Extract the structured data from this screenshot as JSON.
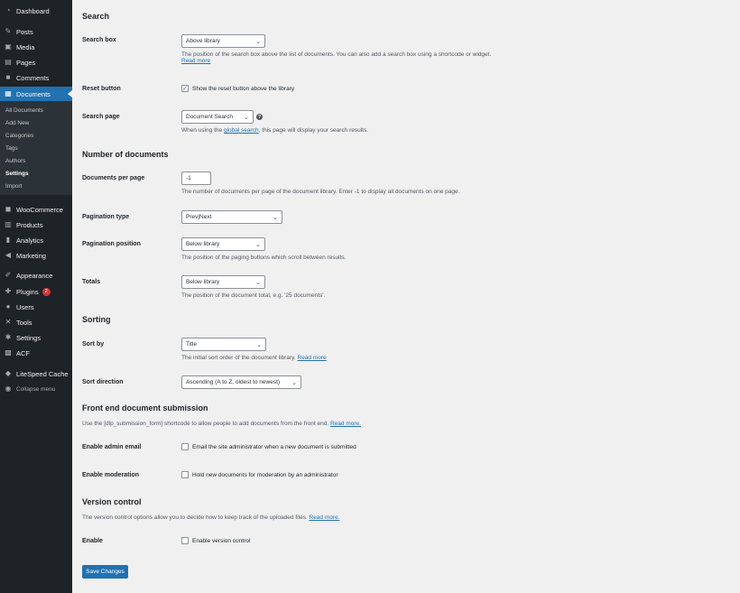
{
  "sidebar": {
    "items": [
      {
        "label": "Dashboard",
        "icon": "dashboard-icon"
      },
      {
        "label": "Posts",
        "icon": "pin-icon"
      },
      {
        "label": "Media",
        "icon": "media-icon"
      },
      {
        "label": "Pages",
        "icon": "pages-icon"
      },
      {
        "label": "Comments",
        "icon": "comments-icon"
      },
      {
        "label": "Documents",
        "icon": "document-icon"
      },
      {
        "label": "WooCommerce",
        "icon": "woocommerce-icon"
      },
      {
        "label": "Products",
        "icon": "products-icon"
      },
      {
        "label": "Analytics",
        "icon": "analytics-icon"
      },
      {
        "label": "Marketing",
        "icon": "megaphone-icon"
      },
      {
        "label": "Appearance",
        "icon": "brush-icon"
      },
      {
        "label": "Plugins",
        "icon": "plugin-icon",
        "badge": "2"
      },
      {
        "label": "Users",
        "icon": "users-icon"
      },
      {
        "label": "Tools",
        "icon": "wrench-icon"
      },
      {
        "label": "Settings",
        "icon": "settings-icon"
      },
      {
        "label": "ACF",
        "icon": "acf-icon"
      },
      {
        "label": "LiteSpeed Cache",
        "icon": "litespeed-icon"
      },
      {
        "label": "Collapse menu",
        "icon": "collapse-icon"
      }
    ],
    "submenu": [
      "All Documents",
      "Add New",
      "Categories",
      "Tags",
      "Authors",
      "Settings",
      "Import"
    ]
  },
  "search": {
    "title": "Search",
    "box_label": "Search box",
    "box_value": "Above library",
    "box_desc": "The position of the search box above the list of documents. You can also add a search box using a shortcode or widget.",
    "read_more": "Read more",
    "reset_label": "Reset button",
    "reset_text": "Show the reset button above the library",
    "reset_checked": true,
    "page_label": "Search page",
    "page_value": "Document Search",
    "page_desc_pre": "When using the",
    "page_desc_link": "global search",
    "page_desc_post": ", this page will display your search results."
  },
  "number": {
    "title": "Number of documents",
    "per_page_label": "Documents per page",
    "per_page_value": "-1",
    "per_page_desc": "The number of documents per page of the document library. Enter -1 to display all documents on one page.",
    "pag_type_label": "Pagination type",
    "pag_type_value": "Prev|Next",
    "pag_pos_label": "Pagination position",
    "pag_pos_value": "Below library",
    "pag_pos_desc": "The position of the paging buttons which scroll between results.",
    "totals_label": "Totals",
    "totals_value": "Below library",
    "totals_desc": "The position of the document total, e.g. '25 documents'."
  },
  "sorting": {
    "title": "Sorting",
    "sort_by_label": "Sort by",
    "sort_by_value": "Title",
    "sort_by_desc": "The initial sort order of the document library.",
    "read_more": "Read more",
    "dir_label": "Sort direction",
    "dir_value": "Ascending (A to Z, oldest to newest)"
  },
  "frontend": {
    "title": "Front end document submission",
    "desc": "Use the [dlp_submission_form] shortcode to allow people to add documents from the front end.",
    "read_more": "Read more.",
    "email_label": "Enable admin email",
    "email_text": "Email the site administrator when a new document is submitted",
    "moderation_label": "Enable moderation",
    "moderation_text": "Hold new documents for moderation by an administrator"
  },
  "version": {
    "title": "Version control",
    "desc": "The version control options allow you to decide how to keep track of the uploaded files.",
    "read_more": "Read more.",
    "enable_label": "Enable",
    "enable_text": "Enable version control"
  },
  "save_label": "Save Changes",
  "colors": {
    "sidebar": "#1d2327",
    "accent": "#2271b1",
    "badge": "#d63638"
  }
}
